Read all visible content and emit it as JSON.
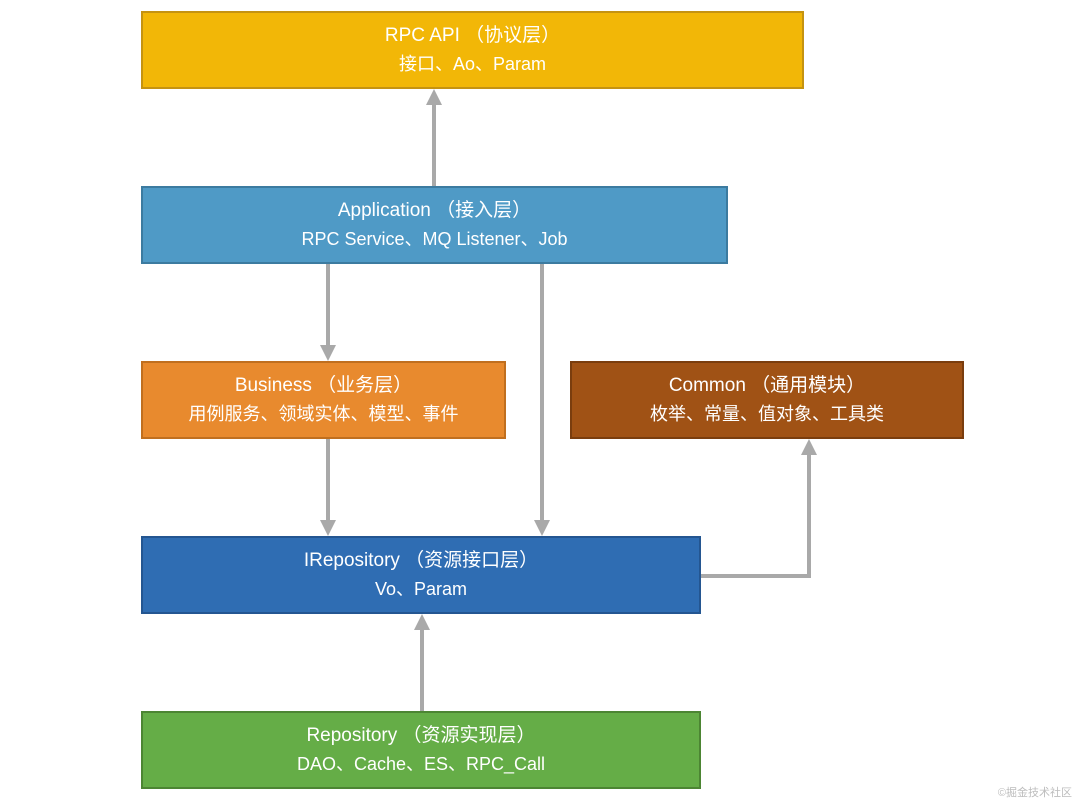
{
  "boxes": {
    "rpc_api": {
      "title": "RPC API （协议层）",
      "sub": "接口、Ao、Param"
    },
    "application": {
      "title": "Application （接入层）",
      "sub": "RPC Service、MQ Listener、Job"
    },
    "business": {
      "title": "Business （业务层）",
      "sub": "用例服务、领域实体、模型、事件"
    },
    "common": {
      "title": "Common （通用模块）",
      "sub": "枚举、常量、值对象、工具类"
    },
    "irepo": {
      "title": "IRepository （资源接口层）",
      "sub": "Vo、Param"
    },
    "repo": {
      "title": "Repository （资源实现层）",
      "sub": "DAO、Cache、ES、RPC_Call"
    }
  },
  "watermark": "©掘金技术社区"
}
